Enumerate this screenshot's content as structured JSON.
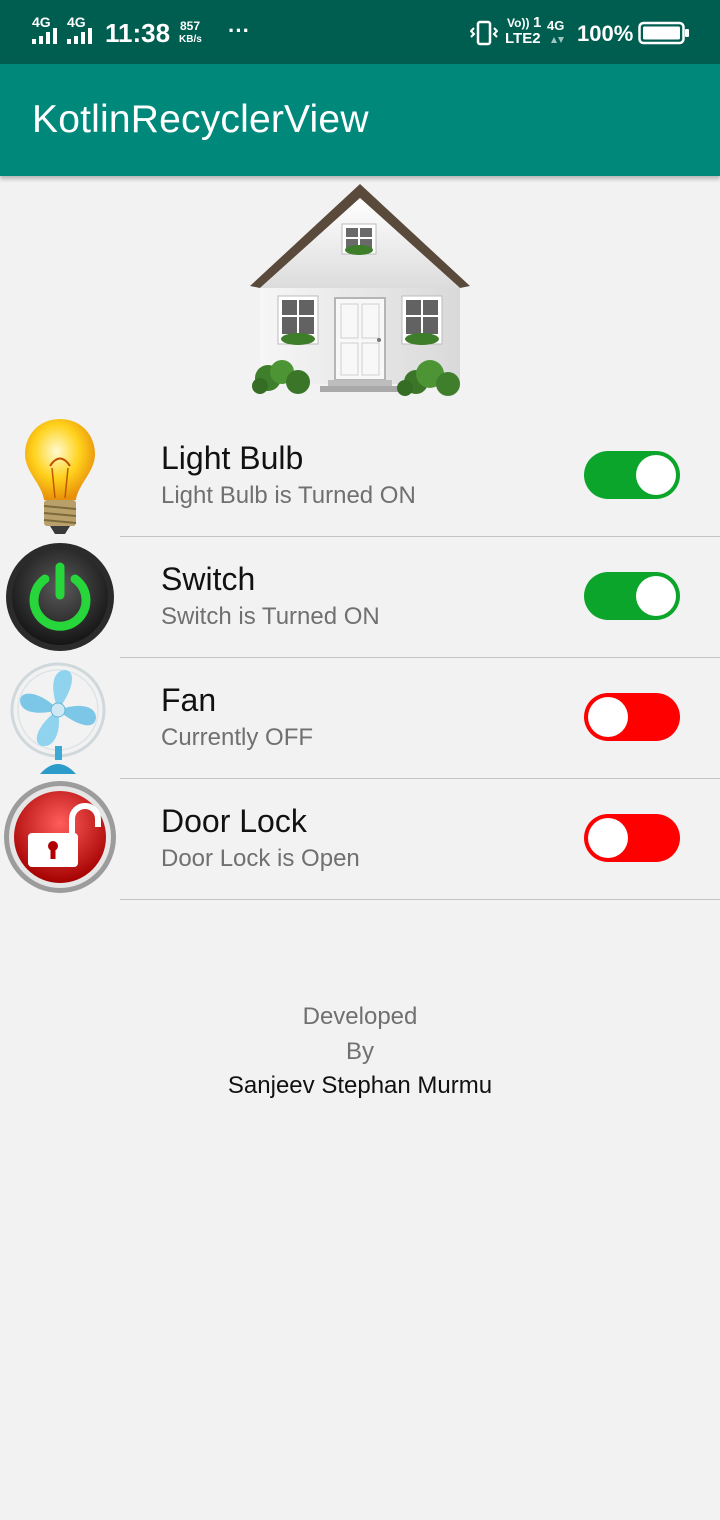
{
  "status_bar": {
    "network1": "4G",
    "network2": "4G",
    "time": "11:38",
    "speed_value": "857",
    "speed_unit": "KB/s",
    "more": "···",
    "volte": "Vo))",
    "lte": "LTE2",
    "sim_index": "1",
    "network3": "4G",
    "battery": "100%"
  },
  "app_bar": {
    "title": "KotlinRecyclerView"
  },
  "devices": [
    {
      "title": "Light Bulb",
      "subtitle": "Light Bulb is Turned ON",
      "enabled": true,
      "icon": "light-bulb-icon"
    },
    {
      "title": "Switch",
      "subtitle": "Switch is Turned ON",
      "enabled": true,
      "icon": "power-switch-icon"
    },
    {
      "title": "Fan",
      "subtitle": "Currently OFF",
      "enabled": false,
      "icon": "fan-icon"
    },
    {
      "title": "Door Lock",
      "subtitle": "Door Lock is Open",
      "enabled": false,
      "icon": "unlocked-padlock-icon"
    }
  ],
  "footer": {
    "line1": "Developed",
    "line2": "By",
    "author": "Sanjeev Stephan Murmu"
  },
  "colors": {
    "status_bar": "#005e50",
    "app_bar": "#00897b",
    "toggle_on": "#0aa52a",
    "toggle_off": "#ff0000",
    "background": "#f2f2f2"
  }
}
